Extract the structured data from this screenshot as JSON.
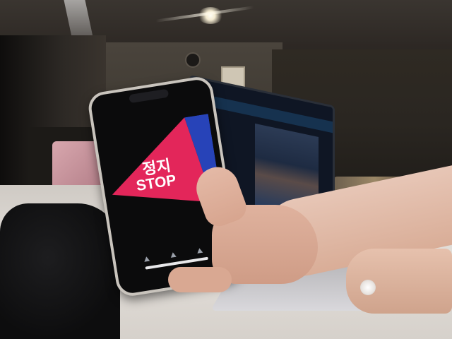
{
  "phone_screen": {
    "korean_text": "정지",
    "english_text": "STOP",
    "colors": {
      "triangle": "#e3265a",
      "side_bar": "#2743b8",
      "background": "#0b0b0c"
    }
  }
}
